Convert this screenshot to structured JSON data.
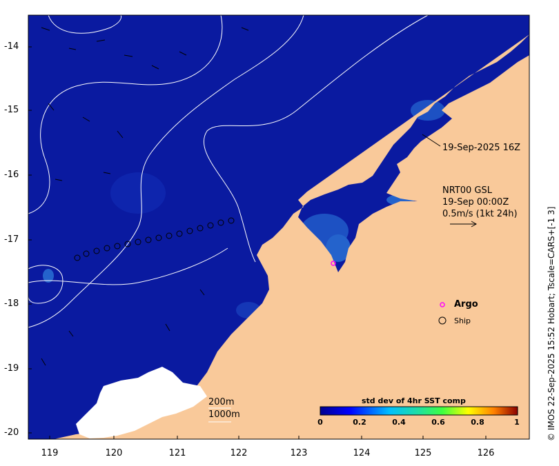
{
  "axes": {
    "lat_ticks": [
      "-14",
      "-15",
      "-16",
      "-17",
      "-18",
      "-19",
      "-20"
    ],
    "lon_ticks": [
      "119",
      "120",
      "121",
      "122",
      "123",
      "124",
      "125",
      "126"
    ]
  },
  "annotations": {
    "timestamp": "19-Sep-2025 16Z",
    "current_source": "NRT00 GSL",
    "current_time": "19-Sep 00:00Z",
    "current_scale": "0.5m/s (1kt 24h)",
    "depth_200": "200m",
    "depth_1000": "1000m"
  },
  "legend": {
    "argo": "Argo",
    "ship": "Ship",
    "argo_color": "#ff00ff"
  },
  "colorbar": {
    "title": "std dev of 4hr SST comp",
    "ticks": [
      "0",
      "0.2",
      "0.4",
      "0.6",
      "0.8",
      "1"
    ]
  },
  "credit": "© IMOS 22-Sep-2025 15:52 Hobart; Tscale=CARS+[-1 3]",
  "colors": {
    "ocean": "#0a1aa0",
    "land": "#f9c99a",
    "nodata": "#ffffff"
  }
}
